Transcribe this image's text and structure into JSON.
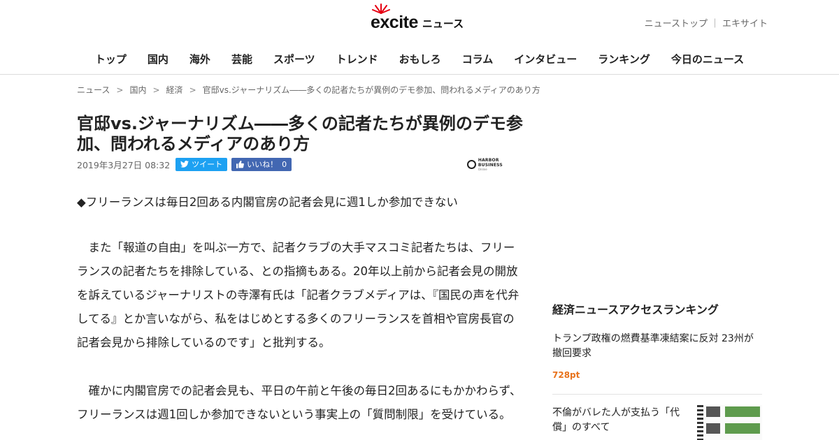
{
  "header": {
    "logo_text": "excite",
    "logo_news": "ニュース",
    "links": [
      "ニューストップ",
      "エキサイト"
    ],
    "link_separator": "｜"
  },
  "nav": [
    "トップ",
    "国内",
    "海外",
    "芸能",
    "スポーツ",
    "トレンド",
    "おもしろ",
    "コラム",
    "インタビュー",
    "ランキング",
    "今日のニュース"
  ],
  "breadcrumb": {
    "items": [
      "ニュース",
      "国内",
      "経済",
      "官邸vs.ジャーナリズム――多くの記者たちが異例のデモ参加、問われるメディアのあり方"
    ],
    "separator": ">"
  },
  "article": {
    "title": "官邸vs.ジャーナリズム――多くの記者たちが異例のデモ参加、問われるメディアのあり方",
    "date": "2019年3月27日 08:32",
    "tweet_label": "ツイート",
    "like_label": "いいね！",
    "like_count": "0",
    "source_name": "HARBOR BUSINESS",
    "source_sub": "Online",
    "subhead": "◆フリーランスは毎日2回ある内閣官房の記者会見に週1しか参加できない",
    "paragraph1": "　また「報道の自由」を叫ぶ一方で、記者クラブの大手マスコミ記者たちは、フリーランスの記者たちを排除している、との指摘もある。20年以上前から記者会見の開放を訴えているジャーナリストの寺澤有氏は「記者クラブメディアは、『国民の声を代弁してる』とか言いながら、私をはじめとする多くのフリーランスを首相や官房長官の記者会見から排除しているのです」と批判する。",
    "paragraph2": "　確かに内閣官房での記者会見も、平日の午前と午後の毎日2回あるにもかかわらず、フリーランスは週1回しか参加できないという事実上の「質問制限」を受けている。"
  },
  "sidebar": {
    "ranking_heading": "経済ニュースアクセスランキング",
    "items": [
      {
        "title": "トランプ政権の燃費基準凍結案に反対 23州が撤回要求",
        "points": "728pt"
      },
      {
        "title": "不倫がバレた人が支払う「代償」のすべて"
      }
    ]
  },
  "colors": {
    "tweet": "#1da1f2",
    "like": "#4267b2",
    "points": "#e8731c",
    "logo_burst": "#e60012"
  }
}
